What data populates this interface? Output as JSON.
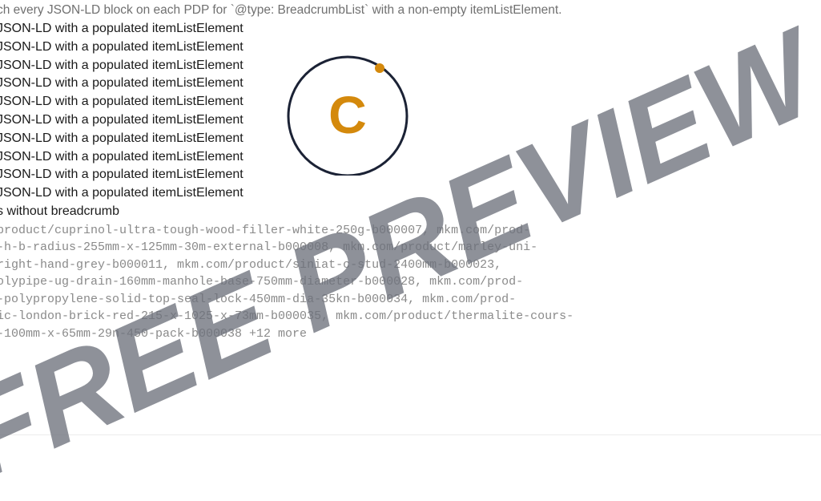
{
  "intro_text": "ch every JSON-LD block on each PDP for `@type: BreadcrumbList` with a non-empty itemListElement.",
  "results": [
    "JSON-LD with a populated itemListElement",
    "JSON-LD with a populated itemListElement",
    "JSON-LD with a populated itemListElement",
    "JSON-LD with a populated itemListElement",
    "JSON-LD with a populated itemListElement",
    "JSON-LD with a populated itemListElement",
    "JSON-LD with a populated itemListElement",
    "JSON-LD with a populated itemListElement",
    "JSON-LD with a populated itemListElement",
    "JSON-LD with a populated itemListElement"
  ],
  "summary_text": "s without breadcrumb",
  "url_lines": [
    "product/cuprinol-ultra-tough-wood-filler-white-250g-b000007, mkm.com/prod-",
    "-h-b-radius-255mm-x-125mm-30m-external-b000008, mkm.com/product/marley-uni-",
    "right-hand-grey-b000011, mkm.com/product/siniat-c-stud-2400mm-b000023,",
    "olypipe-ug-drain-160mm-manhole-base-750mm-diameter-b000028, mkm.com/prod-",
    "-polypropylene-solid-top-seal-lock-450mm-dia-35kn-b000034, mkm.com/prod-",
    "ic-london-brick-red-215-x-1025-x-73mm-b000035, mkm.com/product/thermalite-cours-",
    "-100mm-x-65mm-29n-450-pack-b000038 +12 more"
  ],
  "logo": {
    "letter": "C",
    "ring_color": "#1b2235",
    "accent_color": "#d4890c"
  },
  "watermark": {
    "text": "FREE PREVIEW",
    "color": "#6e727c"
  }
}
